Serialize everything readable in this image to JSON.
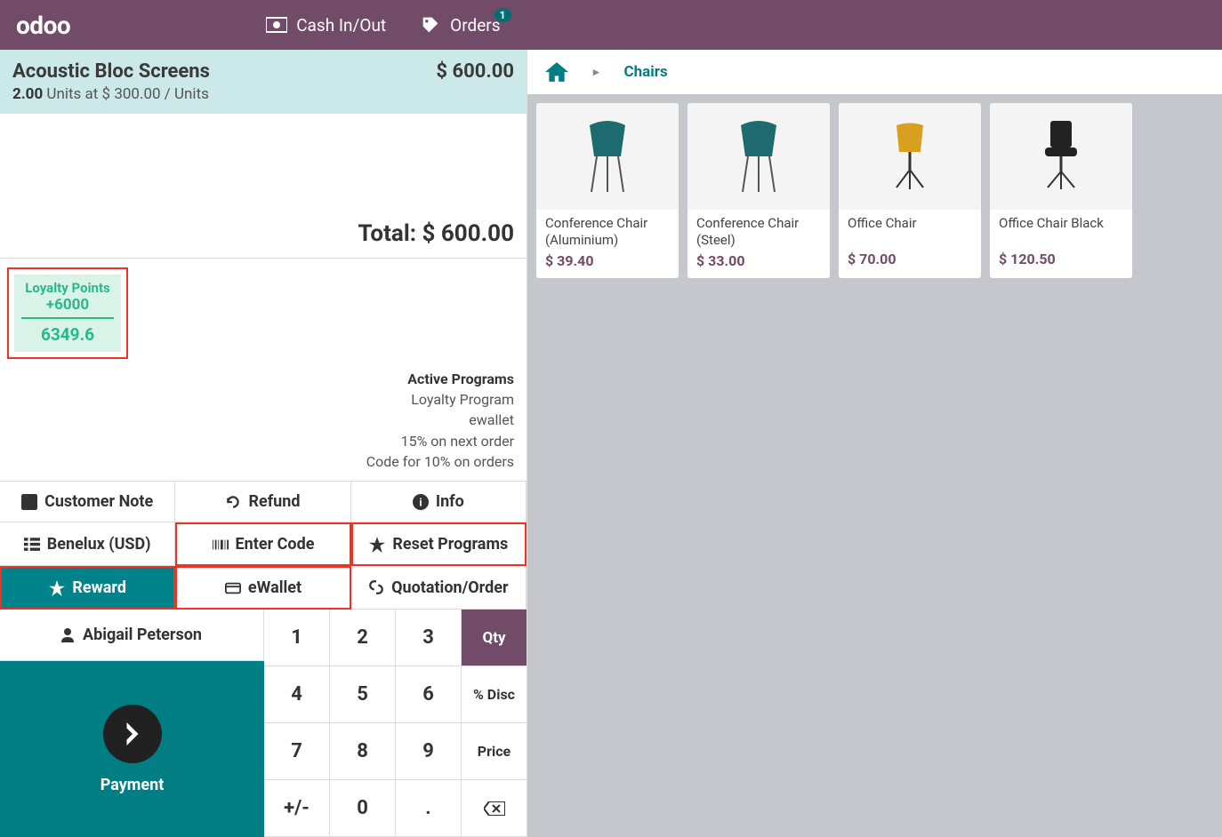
{
  "topbar": {
    "logo": "odoo",
    "cash_label": "Cash In/Out",
    "orders_label": "Orders",
    "orders_badge": "1"
  },
  "orderline": {
    "name": "Acoustic Bloc Screens",
    "qty": "2.00",
    "unit_text": "Units at $ 300.00 / Units",
    "price": "$ 600.00"
  },
  "total_label": "Total: $ 600.00",
  "loyalty": {
    "label": "Loyalty Points",
    "add": "+6000",
    "total": "6349.6"
  },
  "programs": {
    "head": "Active Programs",
    "items": [
      "Loyalty Program",
      "ewallet",
      "15% on next order",
      "Code for 10% on orders"
    ]
  },
  "buttons": {
    "customer_note": "Customer Note",
    "refund": "Refund",
    "info": "Info",
    "benelux": "Benelux (USD)",
    "enter_code": "Enter Code",
    "reset_programs": "Reset Programs",
    "reward": "Reward",
    "ewallet": "eWallet",
    "quotation": "Quotation/Order"
  },
  "customer_name": "Abigail Peterson",
  "numpad": {
    "qty": "Qty",
    "disc": "% Disc",
    "price": "Price",
    "k1": "1",
    "k2": "2",
    "k3": "3",
    "k4": "4",
    "k5": "5",
    "k6": "6",
    "k7": "7",
    "k8": "8",
    "k9": "9",
    "k0": "0",
    "sign": "+/-",
    "dot": "."
  },
  "payment_label": "Payment",
  "breadcrumb": {
    "category": "Chairs"
  },
  "products": [
    {
      "name": "Conference Chair (Aluminium)",
      "price": "$ 39.40"
    },
    {
      "name": "Conference Chair (Steel)",
      "price": "$ 33.00"
    },
    {
      "name": "Office Chair",
      "price": "$ 70.00"
    },
    {
      "name": "Office Chair Black",
      "price": "$ 120.50"
    }
  ]
}
